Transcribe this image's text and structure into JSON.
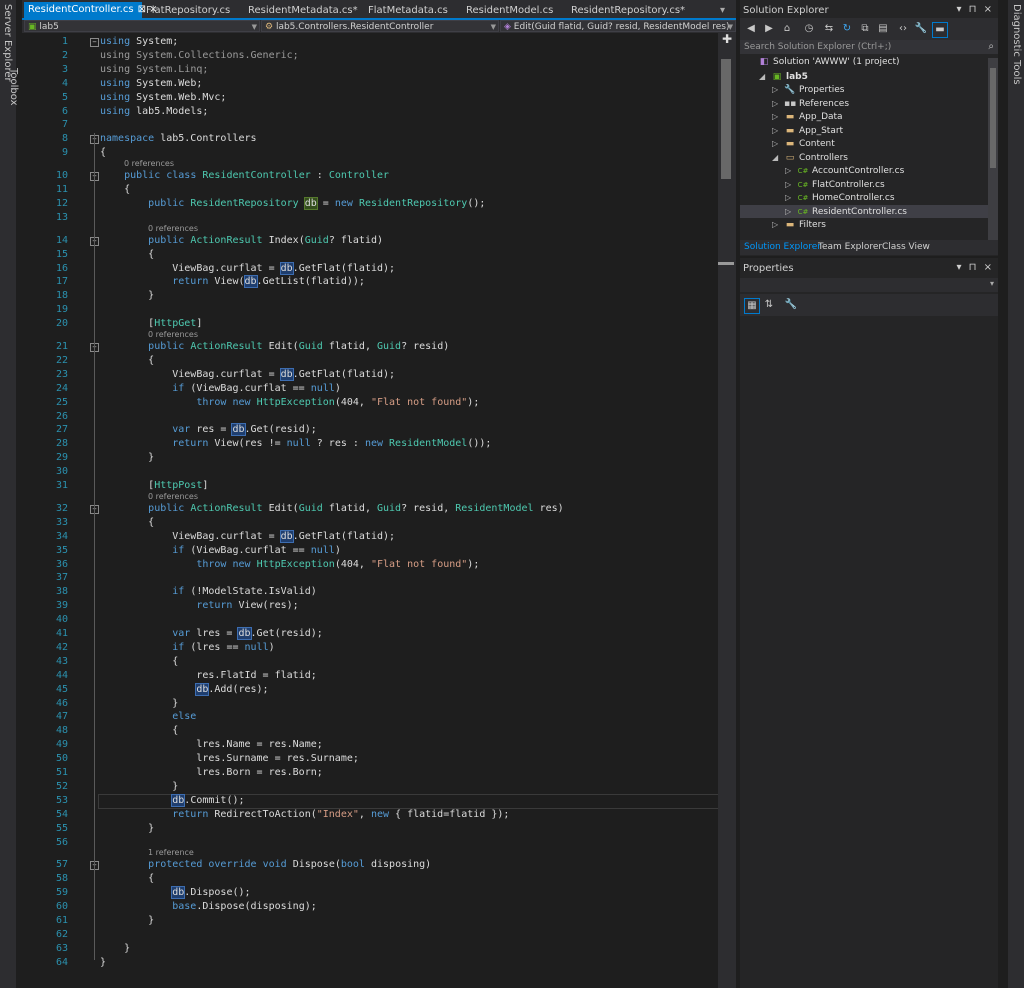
{
  "left_strip": {
    "server_explorer": "Server Explorer",
    "toolbox": "Toolbox"
  },
  "right_strip": {
    "diagnostic_tools": "Diagnostic Tools"
  },
  "tabs": [
    {
      "label": "ResidentController.cs",
      "active": true
    },
    {
      "label": "FlatRepository.cs",
      "active": false
    },
    {
      "label": "ResidentMetadata.cs*",
      "active": false
    },
    {
      "label": "FlatMetadata.cs",
      "active": false
    },
    {
      "label": "ResidentModel.cs",
      "active": false
    },
    {
      "label": "ResidentRepository.cs*",
      "active": false
    }
  ],
  "tab_close_glyph": "⊠ ×",
  "navbar": {
    "project": "lab5",
    "class": "lab5.Controllers.ResidentController",
    "member": "Edit(Guid flatid, Guid? resid, ResidentModel res)"
  },
  "codelens": {
    "l10": "0 references",
    "l14": "0 references",
    "l21": "0 references",
    "l32": "0 references",
    "l57": "1 reference"
  },
  "code_lines": [
    {
      "n": "1",
      "html": "<span class=\"kw\">using</span> System;"
    },
    {
      "n": "2",
      "html": "<span class=\"kw dim\">using</span><span class=\"dim\"> System.Collections.Generic;</span>"
    },
    {
      "n": "3",
      "html": "<span class=\"kw dim\">using</span><span class=\"dim\"> System.Linq;</span>"
    },
    {
      "n": "4",
      "html": "<span class=\"kw\">using</span> System.Web;"
    },
    {
      "n": "5",
      "html": "<span class=\"kw\">using</span> System.Web.Mvc;"
    },
    {
      "n": "6",
      "html": "<span class=\"kw\">using</span> lab5.Models;"
    },
    {
      "n": "7",
      "html": ""
    },
    {
      "n": "8",
      "html": "<span class=\"kw\">namespace</span> lab5.Controllers"
    },
    {
      "n": "9",
      "html": "{"
    },
    {
      "n": "10",
      "html": "    <span class=\"kw\">public</span> <span class=\"kw\">class</span> <span class=\"ty\">ResidentController</span> : <span class=\"ty\">Controller</span>"
    },
    {
      "n": "11",
      "html": "    {"
    },
    {
      "n": "12",
      "html": "        <span class=\"kw\">public</span> <span class=\"ty\">ResidentRepository</span> <span class=\"hlg\">db</span> = <span class=\"kw\">new</span> <span class=\"ty\">ResidentRepository</span>();"
    },
    {
      "n": "13",
      "html": ""
    },
    {
      "n": "14",
      "html": "        <span class=\"kw\">public</span> <span class=\"ty\">ActionResult</span> Index(<span class=\"ty\">Guid</span>? flatid)"
    },
    {
      "n": "15",
      "html": "        {"
    },
    {
      "n": "16",
      "html": "            ViewBag.curflat = <span class=\"hl\">db</span>.GetFlat(flatid);"
    },
    {
      "n": "17",
      "html": "            <span class=\"kw\">return</span> View(<span class=\"hl\">db</span>.GetList(flatid));"
    },
    {
      "n": "18",
      "html": "        }"
    },
    {
      "n": "19",
      "html": ""
    },
    {
      "n": "20",
      "html": "        [<span class=\"ty\">HttpGet</span>]"
    },
    {
      "n": "21",
      "html": "        <span class=\"kw\">public</span> <span class=\"ty\">ActionResult</span> Edit(<span class=\"ty\">Guid</span> flatid, <span class=\"ty\">Guid</span>? resid)"
    },
    {
      "n": "22",
      "html": "        {"
    },
    {
      "n": "23",
      "html": "            ViewBag.curflat = <span class=\"hl\">db</span>.GetFlat(flatid);"
    },
    {
      "n": "24",
      "html": "            <span class=\"kw\">if</span> (ViewBag.curflat == <span class=\"kw\">null</span>)"
    },
    {
      "n": "25",
      "html": "                <span class=\"kw\">throw</span> <span class=\"kw\">new</span> <span class=\"ty\">HttpException</span>(404, <span class=\"st\">\"Flat not found\"</span>);"
    },
    {
      "n": "26",
      "html": ""
    },
    {
      "n": "27",
      "html": "            <span class=\"kw\">var</span> res = <span class=\"hl\">db</span>.Get(resid);"
    },
    {
      "n": "28",
      "html": "            <span class=\"kw\">return</span> View(res != <span class=\"kw\">null</span> ? res : <span class=\"kw\">new</span> <span class=\"ty\">ResidentModel</span>());"
    },
    {
      "n": "29",
      "html": "        }"
    },
    {
      "n": "30",
      "html": ""
    },
    {
      "n": "31",
      "html": "        [<span class=\"ty\">HttpPost</span>]"
    },
    {
      "n": "32",
      "html": "        <span class=\"kw\">public</span> <span class=\"ty\">ActionResult</span> Edit(<span class=\"ty\">Guid</span> flatid, <span class=\"ty\">Guid</span>? resid, <span class=\"ty\">ResidentModel</span> res)"
    },
    {
      "n": "33",
      "html": "        {"
    },
    {
      "n": "34",
      "html": "            ViewBag.curflat = <span class=\"hl\">db</span>.GetFlat(flatid);"
    },
    {
      "n": "35",
      "html": "            <span class=\"kw\">if</span> (ViewBag.curflat == <span class=\"kw\">null</span>)"
    },
    {
      "n": "36",
      "html": "                <span class=\"kw\">throw</span> <span class=\"kw\">new</span> <span class=\"ty\">HttpException</span>(404, <span class=\"st\">\"Flat not found\"</span>);"
    },
    {
      "n": "37",
      "html": ""
    },
    {
      "n": "38",
      "html": "            <span class=\"kw\">if</span> (!ModelState.IsValid)"
    },
    {
      "n": "39",
      "html": "                <span class=\"kw\">return</span> View(res);"
    },
    {
      "n": "40",
      "html": ""
    },
    {
      "n": "41",
      "html": "            <span class=\"kw\">var</span> lres = <span class=\"hl\">db</span>.Get(resid);"
    },
    {
      "n": "42",
      "html": "            <span class=\"kw\">if</span> (lres == <span class=\"kw\">null</span>)"
    },
    {
      "n": "43",
      "html": "            {"
    },
    {
      "n": "44",
      "html": "                res.FlatId = flatid;"
    },
    {
      "n": "45",
      "html": "                <span class=\"hl\">db</span>.Add(res);"
    },
    {
      "n": "46",
      "html": "            }"
    },
    {
      "n": "47",
      "html": "            <span class=\"kw\">else</span>"
    },
    {
      "n": "48",
      "html": "            {"
    },
    {
      "n": "49",
      "html": "                lres.Name = res.Name;"
    },
    {
      "n": "50",
      "html": "                lres.Surname = res.Surname;"
    },
    {
      "n": "51",
      "html": "                lres.Born = res.Born;"
    },
    {
      "n": "52",
      "html": "            }"
    },
    {
      "n": "53",
      "html": "            <span class=\"hl\">db</span>.Commit();"
    },
    {
      "n": "54",
      "html": "            <span class=\"kw\">return</span> RedirectToAction(<span class=\"st\">\"Index\"</span>, <span class=\"kw\">new</span> { flatid=flatid });"
    },
    {
      "n": "55",
      "html": "        }"
    },
    {
      "n": "56",
      "html": ""
    },
    {
      "n": "57",
      "html": "        <span class=\"kw\">protected</span> <span class=\"kw\">override</span> <span class=\"kw\">void</span> Dispose(<span class=\"kw\">bool</span> disposing)"
    },
    {
      "n": "58",
      "html": "        {"
    },
    {
      "n": "59",
      "html": "            <span class=\"hl\">db</span>.Dispose();"
    },
    {
      "n": "60",
      "html": "            <span class=\"kw\">base</span>.Dispose(disposing);"
    },
    {
      "n": "61",
      "html": "        }"
    },
    {
      "n": "62",
      "html": ""
    },
    {
      "n": "63",
      "html": "    }"
    },
    {
      "n": "64",
      "html": "}"
    }
  ],
  "solution_explorer": {
    "title": "Solution Explorer",
    "search_placeholder": "Search Solution Explorer (Ctrl+;)",
    "items": [
      {
        "label": "Solution 'AWWW' (1 project)",
        "icon": "solution-icon",
        "level": 0,
        "arrow": ""
      },
      {
        "label": "lab5",
        "icon": "csproj-icon",
        "level": 1,
        "arrow": "◢"
      },
      {
        "label": "Properties",
        "icon": "wrench-icon",
        "level": 2,
        "arrow": "▷"
      },
      {
        "label": "References",
        "icon": "references-icon",
        "level": 2,
        "arrow": "▷"
      },
      {
        "label": "App_Data",
        "icon": "folder-icon",
        "level": 2,
        "arrow": "▷"
      },
      {
        "label": "App_Start",
        "icon": "folder-icon",
        "level": 2,
        "arrow": "▷"
      },
      {
        "label": "Content",
        "icon": "folder-icon",
        "level": 2,
        "arrow": "▷"
      },
      {
        "label": "Controllers",
        "icon": "folder-open-icon",
        "level": 2,
        "arrow": "◢"
      },
      {
        "label": "AccountController.cs",
        "icon": "csharp-file-icon",
        "level": 3,
        "arrow": "▷"
      },
      {
        "label": "FlatController.cs",
        "icon": "csharp-file-icon",
        "level": 3,
        "arrow": "▷"
      },
      {
        "label": "HomeController.cs",
        "icon": "csharp-file-icon",
        "level": 3,
        "arrow": "▷"
      },
      {
        "label": "ResidentController.cs",
        "icon": "csharp-file-icon",
        "level": 3,
        "arrow": "▷",
        "selected": true
      },
      {
        "label": "Filters",
        "icon": "folder-icon",
        "level": 2,
        "arrow": "▷"
      }
    ],
    "bottom_tabs": [
      "Solution Explorer",
      "Team Explorer",
      "Class View"
    ]
  },
  "properties": {
    "title": "Properties"
  },
  "window_buttons": "▾ ⊓ ×",
  "colors": {
    "accent": "#007acc",
    "keyword": "#569cd6",
    "type": "#4ec9b0",
    "string": "#d69d85",
    "line_number": "#2b91af"
  }
}
